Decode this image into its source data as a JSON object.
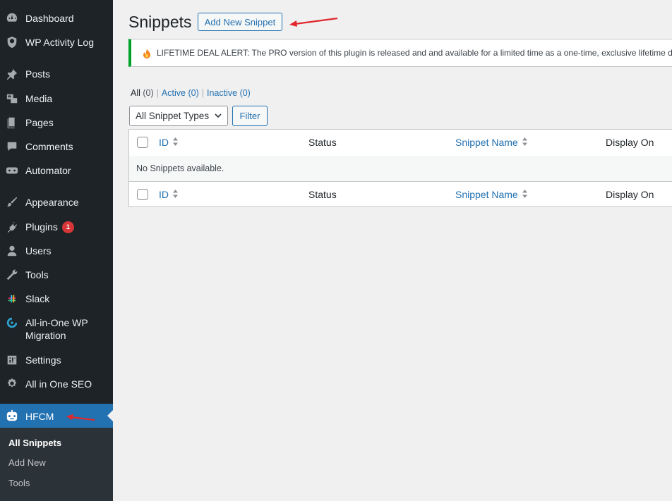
{
  "sidebar": {
    "items": [
      {
        "label": "Dashboard",
        "icon": "dashboard-icon"
      },
      {
        "label": "WP Activity Log",
        "icon": "shield-icon"
      },
      {
        "label": "Posts",
        "icon": "pin-icon"
      },
      {
        "label": "Media",
        "icon": "media-icon"
      },
      {
        "label": "Pages",
        "icon": "pages-icon"
      },
      {
        "label": "Comments",
        "icon": "comment-icon"
      },
      {
        "label": "Automator",
        "icon": "robot-icon"
      },
      {
        "label": "Appearance",
        "icon": "brush-icon"
      },
      {
        "label": "Plugins",
        "icon": "plugin-icon",
        "badge": "1"
      },
      {
        "label": "Users",
        "icon": "user-icon"
      },
      {
        "label": "Tools",
        "icon": "wrench-icon"
      },
      {
        "label": "Slack",
        "icon": "slack-icon"
      },
      {
        "label": "All-in-One WP Migration",
        "label_line1": "All-in-One WP",
        "label_line2": "Migration",
        "icon": "migration-icon"
      },
      {
        "label": "Settings",
        "icon": "settings-icon"
      },
      {
        "label": "All in One SEO",
        "icon": "seo-icon"
      },
      {
        "label": "HFCM",
        "icon": "hfcm-robot-icon",
        "active": true
      }
    ],
    "submenu": [
      "All Snippets",
      "Add New",
      "Tools"
    ],
    "colors": {
      "background": "#1d2327",
      "active": "#2271b1",
      "badge": "#d63638"
    }
  },
  "header": {
    "title": "Snippets",
    "add_new_label": "Add New Snippet"
  },
  "notice": {
    "icon": "fire-icon",
    "text": "LIFETIME DEAL ALERT: The PRO version of this plugin is released and and available for a limited time as a one-time, exclusive lifetime deal.",
    "color": "#00a32a"
  },
  "filters": {
    "all": "All",
    "all_count": "(0)",
    "active": "Active",
    "active_count": "(0)",
    "inactive": "Inactive",
    "inactive_count": "(0)",
    "separator": "|"
  },
  "controls": {
    "type_select": "All Snippet Types",
    "filter_label": "Filter"
  },
  "table": {
    "columns": [
      "ID",
      "Status",
      "Snippet Name",
      "Display On"
    ],
    "empty_message": "No Snippets available."
  },
  "annotations": {
    "arrow_color": "#e0282c"
  }
}
